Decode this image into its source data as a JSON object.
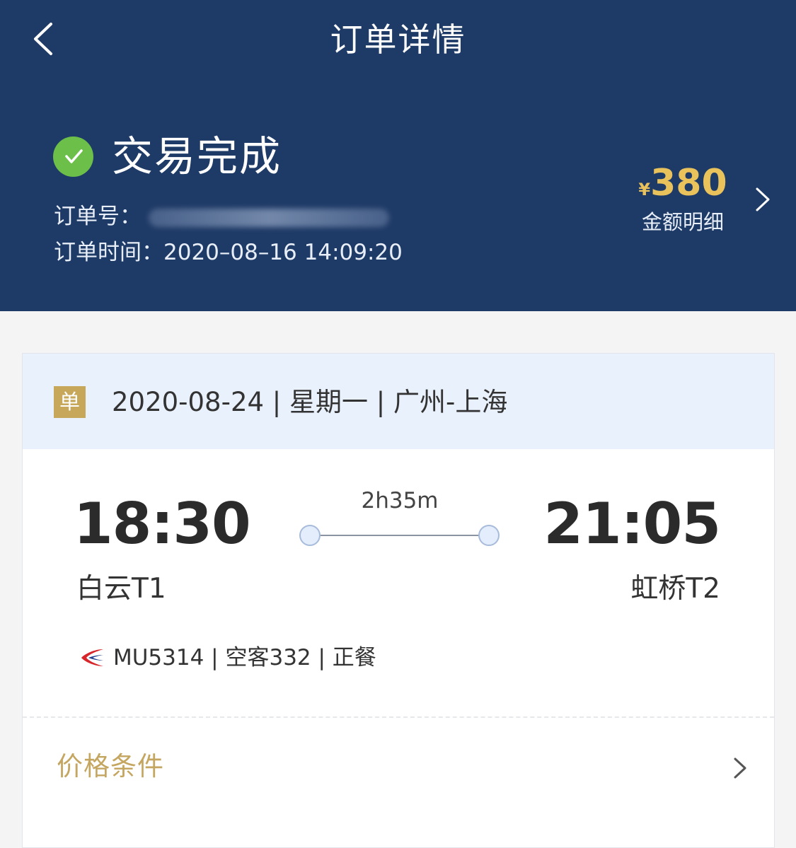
{
  "header": {
    "title": "订单详情",
    "back_icon": "chevron-left-icon",
    "background_color": "#1e3a66"
  },
  "order": {
    "status": "交易完成",
    "status_icon": "check-circle-icon",
    "number_label": "订单号：",
    "time_label": "订单时间：",
    "time_value": "2020–08–16 14:09:20",
    "price_currency": "¥",
    "price_amount": "380",
    "price_detail_label": "金额明细",
    "price_color": "#e9c25c"
  },
  "flight": {
    "tag": "单",
    "summary": "2020-08-24 | 星期一 | 广州-上海",
    "departure_time": "18:30",
    "arrival_time": "21:05",
    "duration": "2h35m",
    "departure_airport": "白云T1",
    "arrival_airport": "虹桥T2",
    "airline_logo_icon": "china-eastern-logo-icon",
    "details": "MU5314 | 空客332 | 正餐"
  },
  "price_conditions": {
    "label": "价格条件",
    "icon": "chevron-right-icon",
    "accent_color": "#c4a660"
  }
}
